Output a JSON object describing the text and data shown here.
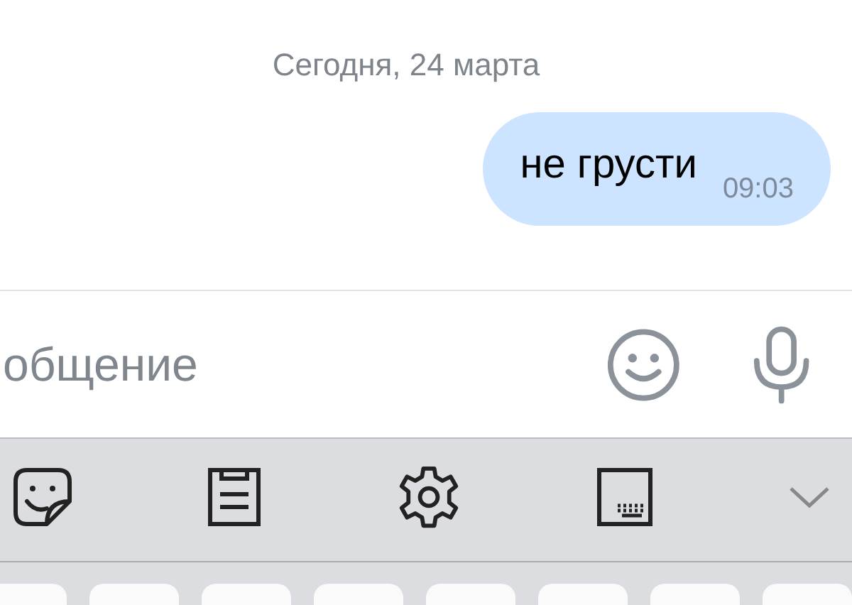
{
  "date_separator": "Сегодня, 24 марта",
  "messages": [
    {
      "text": "не грусти",
      "time": "09:03",
      "outgoing": true
    }
  ],
  "composer": {
    "placeholder": "общение"
  },
  "keyboard_toolbar": {
    "items": [
      {
        "kind": "sticker"
      },
      {
        "kind": "clipboard"
      },
      {
        "kind": "settings"
      },
      {
        "kind": "layout"
      },
      {
        "kind": "collapse"
      }
    ]
  }
}
